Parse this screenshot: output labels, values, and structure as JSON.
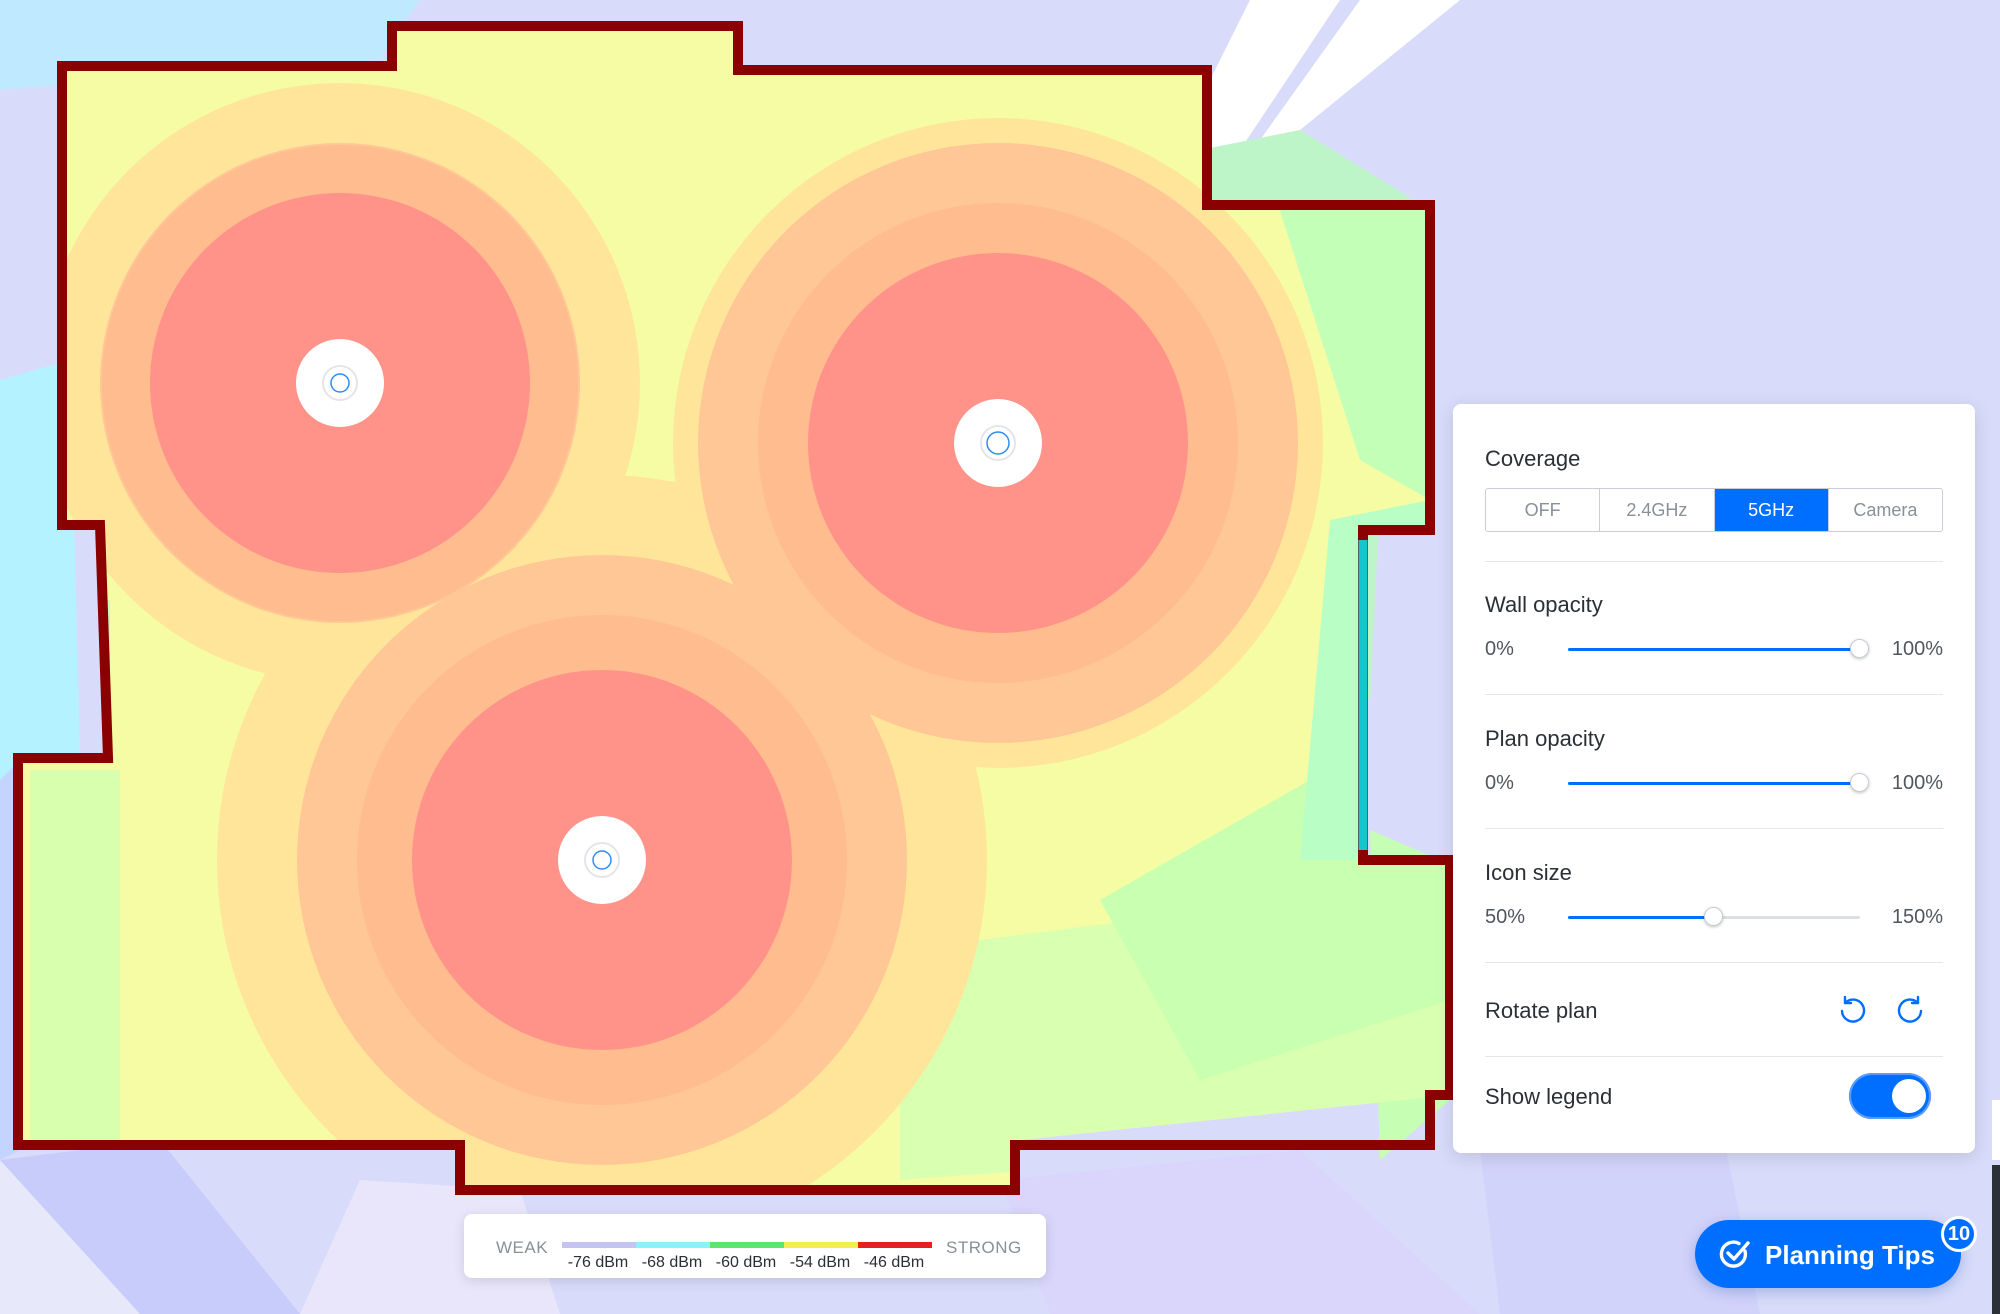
{
  "colors": {
    "accent": "#006fff",
    "wall": "#8b0000",
    "heat_strong": "#ff928a",
    "heat_mid": "#ffc796",
    "heat_warm": "#ffe69a",
    "heat_yellow": "#f8fba6",
    "heat_green": "#b8ffb0",
    "heat_cyan": "#a8f4ff",
    "heat_lavender": "#d0d4fa"
  },
  "map": {
    "access_points": [
      {
        "name": "access-point-1",
        "icon": "unifi-ap-icon"
      },
      {
        "name": "access-point-2",
        "icon": "unifi-ap-icon"
      },
      {
        "name": "access-point-3",
        "icon": "unifi-ap-icon"
      }
    ]
  },
  "panel": {
    "coverage_title": "Coverage",
    "coverage_options": [
      "OFF",
      "2.4GHz",
      "5GHz",
      "Camera"
    ],
    "coverage_selected": "5GHz",
    "wall_opacity": {
      "label": "Wall opacity",
      "min_label": "0%",
      "max_label": "100%",
      "value": 1.0
    },
    "plan_opacity": {
      "label": "Plan opacity",
      "min_label": "0%",
      "max_label": "100%",
      "value": 1.0
    },
    "icon_size": {
      "label": "Icon size",
      "min_label": "50%",
      "max_label": "150%",
      "value": 0.5
    },
    "rotate_plan": {
      "label": "Rotate plan",
      "left_icon": "rotate-ccw-icon",
      "right_icon": "rotate-cw-icon"
    },
    "show_legend": {
      "label": "Show legend",
      "on": true
    }
  },
  "legend": {
    "weak_label": "WEAK",
    "strong_label": "STRONG",
    "ticks": [
      "-76 dBm",
      "-68 dBm",
      "-60 dBm",
      "-54 dBm",
      "-46 dBm"
    ],
    "segment_colors": [
      "#c4c3f2",
      "#8ef0f8",
      "#5fe56a",
      "#f2ee4a",
      "#e61f1f"
    ]
  },
  "planning_tips": {
    "label": "Planning Tips",
    "badge": "10",
    "icon": "check-circle-icon"
  }
}
